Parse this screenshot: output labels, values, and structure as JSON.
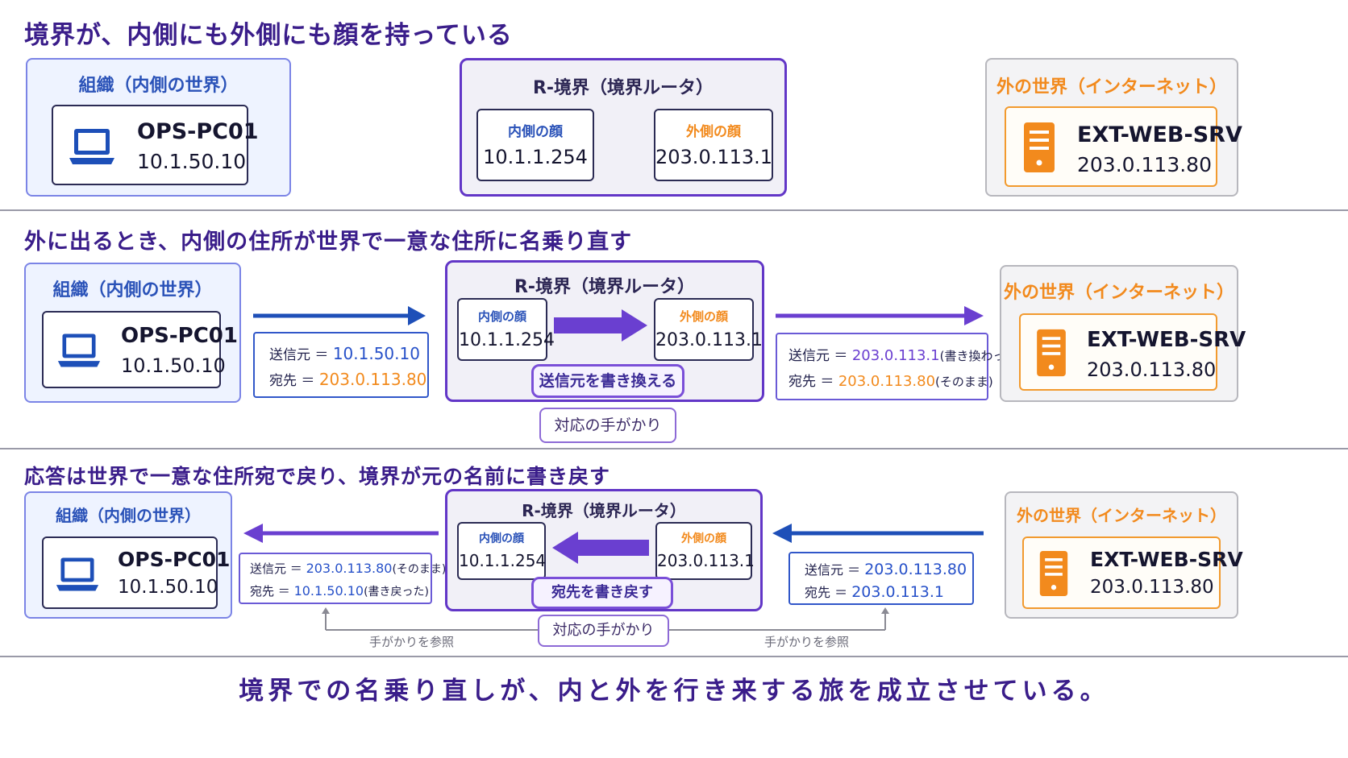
{
  "section1": {
    "heading": "境界が、内側にも外側にも顔を持っている",
    "org": {
      "title": "組織（内側の世界）",
      "host": "OPS-PC01",
      "ip": "10.1.50.10"
    },
    "router": {
      "title": "R-境界（境界ルータ）",
      "inner_label": "内側の顔",
      "inner_ip": "10.1.1.254",
      "outer_label": "外側の顔",
      "outer_ip": "203.0.113.1"
    },
    "ext": {
      "title": "外の世界（インターネット）",
      "host": "EXT-WEB-SRV",
      "ip": "203.0.113.80"
    }
  },
  "section2": {
    "heading": "外に出るとき、内側の住所が世界で一意な住所に名乗り直す",
    "org": {
      "title": "組織（内側の世界）",
      "host": "OPS-PC01",
      "ip": "10.1.50.10"
    },
    "left_packet": {
      "src_label": "送信元 ＝",
      "src": "10.1.50.10",
      "dst_label": "宛先 ＝",
      "dst": "203.0.113.80"
    },
    "router": {
      "title": "R-境界（境界ルータ）",
      "inner_label": "内側の顔",
      "inner_ip": "10.1.1.254",
      "outer_label": "外側の顔",
      "outer_ip": "203.0.113.1",
      "action": "送信元を書き換える"
    },
    "clue": "対応の手がかり",
    "right_packet": {
      "src_label": "送信元 ＝",
      "src": "203.0.113.1",
      "src_note": "(書き換わった)",
      "dst_label": "宛先 ＝",
      "dst": "203.0.113.80",
      "dst_note": "(そのまま)"
    },
    "ext": {
      "title": "外の世界（インターネット）",
      "host": "EXT-WEB-SRV",
      "ip": "203.0.113.80"
    }
  },
  "section3": {
    "heading": "応答は世界で一意な住所宛で戻り、境界が元の名前に書き戻す",
    "org": {
      "title": "組織（内側の世界）",
      "host": "OPS-PC01",
      "ip": "10.1.50.10"
    },
    "left_packet": {
      "src_label": "送信元 ＝",
      "src": "203.0.113.80",
      "src_note": "(そのまま)",
      "dst_label": "宛先 ＝",
      "dst": "10.1.50.10",
      "dst_note": "(書き戻った)"
    },
    "router": {
      "title": "R-境界（境界ルータ）",
      "inner_label": "内側の顔",
      "inner_ip": "10.1.1.254",
      "outer_label": "外側の顔",
      "outer_ip": "203.0.113.1",
      "action": "宛先を書き戻す"
    },
    "clue": "対応の手がかり",
    "ref_left": "手がかりを参照",
    "ref_right": "手がかりを参照",
    "right_packet": {
      "src_label": "送信元 ＝",
      "src": "203.0.113.80",
      "dst_label": "宛先 ＝",
      "dst": "203.0.113.1"
    },
    "ext": {
      "title": "外の世界（インターネット）",
      "host": "EXT-WEB-SRV",
      "ip": "203.0.113.80"
    }
  },
  "footer": "境界での名乗り直しが、内と外を行き来する旅を成立させている。",
  "icons": {
    "pc": "laptop-icon",
    "server": "server-icon"
  },
  "colors": {
    "blue": "#2751c9",
    "purple": "#6a3fd0",
    "orange": "#f28a1d",
    "heading": "#3a1d8a"
  }
}
